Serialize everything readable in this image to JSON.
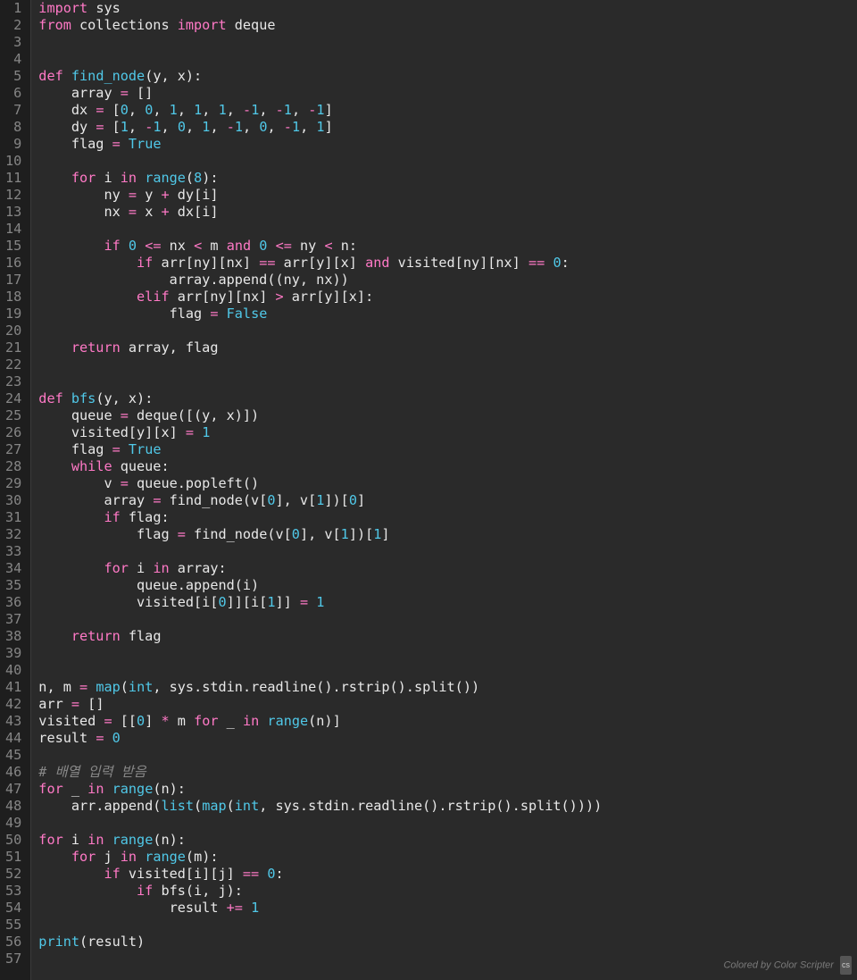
{
  "gutter": {
    "start": 1,
    "end": 57
  },
  "footer": {
    "text": "Colored by Color Scripter",
    "badge": "cs"
  },
  "code": [
    [
      {
        "c": "kw",
        "t": "import"
      },
      {
        "c": "id",
        "t": " sys"
      }
    ],
    [
      {
        "c": "kw",
        "t": "from"
      },
      {
        "c": "id",
        "t": " collections "
      },
      {
        "c": "kw",
        "t": "import"
      },
      {
        "c": "id",
        "t": " deque"
      }
    ],
    [
      {
        "c": "id",
        "t": " "
      }
    ],
    [
      {
        "c": "id",
        "t": " "
      }
    ],
    [
      {
        "c": "kw",
        "t": "def"
      },
      {
        "c": "id",
        "t": " "
      },
      {
        "c": "fn",
        "t": "find_node"
      },
      {
        "c": "id",
        "t": "(y, x):"
      }
    ],
    [
      {
        "c": "id",
        "t": "    array "
      },
      {
        "c": "op",
        "t": "="
      },
      {
        "c": "id",
        "t": " []"
      }
    ],
    [
      {
        "c": "id",
        "t": "    dx "
      },
      {
        "c": "op",
        "t": "="
      },
      {
        "c": "id",
        "t": " ["
      },
      {
        "c": "num",
        "t": "0"
      },
      {
        "c": "id",
        "t": ", "
      },
      {
        "c": "num",
        "t": "0"
      },
      {
        "c": "id",
        "t": ", "
      },
      {
        "c": "num",
        "t": "1"
      },
      {
        "c": "id",
        "t": ", "
      },
      {
        "c": "num",
        "t": "1"
      },
      {
        "c": "id",
        "t": ", "
      },
      {
        "c": "num",
        "t": "1"
      },
      {
        "c": "id",
        "t": ", "
      },
      {
        "c": "op",
        "t": "-"
      },
      {
        "c": "num",
        "t": "1"
      },
      {
        "c": "id",
        "t": ", "
      },
      {
        "c": "op",
        "t": "-"
      },
      {
        "c": "num",
        "t": "1"
      },
      {
        "c": "id",
        "t": ", "
      },
      {
        "c": "op",
        "t": "-"
      },
      {
        "c": "num",
        "t": "1"
      },
      {
        "c": "id",
        "t": "]"
      }
    ],
    [
      {
        "c": "id",
        "t": "    dy "
      },
      {
        "c": "op",
        "t": "="
      },
      {
        "c": "id",
        "t": " ["
      },
      {
        "c": "num",
        "t": "1"
      },
      {
        "c": "id",
        "t": ", "
      },
      {
        "c": "op",
        "t": "-"
      },
      {
        "c": "num",
        "t": "1"
      },
      {
        "c": "id",
        "t": ", "
      },
      {
        "c": "num",
        "t": "0"
      },
      {
        "c": "id",
        "t": ", "
      },
      {
        "c": "num",
        "t": "1"
      },
      {
        "c": "id",
        "t": ", "
      },
      {
        "c": "op",
        "t": "-"
      },
      {
        "c": "num",
        "t": "1"
      },
      {
        "c": "id",
        "t": ", "
      },
      {
        "c": "num",
        "t": "0"
      },
      {
        "c": "id",
        "t": ", "
      },
      {
        "c": "op",
        "t": "-"
      },
      {
        "c": "num",
        "t": "1"
      },
      {
        "c": "id",
        "t": ", "
      },
      {
        "c": "num",
        "t": "1"
      },
      {
        "c": "id",
        "t": "]"
      }
    ],
    [
      {
        "c": "id",
        "t": "    flag "
      },
      {
        "c": "op",
        "t": "="
      },
      {
        "c": "id",
        "t": " "
      },
      {
        "c": "fn",
        "t": "True"
      }
    ],
    [
      {
        "c": "id",
        "t": " "
      }
    ],
    [
      {
        "c": "id",
        "t": "    "
      },
      {
        "c": "kw",
        "t": "for"
      },
      {
        "c": "id",
        "t": " i "
      },
      {
        "c": "kw",
        "t": "in"
      },
      {
        "c": "id",
        "t": " "
      },
      {
        "c": "fn",
        "t": "range"
      },
      {
        "c": "id",
        "t": "("
      },
      {
        "c": "num",
        "t": "8"
      },
      {
        "c": "id",
        "t": "):"
      }
    ],
    [
      {
        "c": "id",
        "t": "        ny "
      },
      {
        "c": "op",
        "t": "="
      },
      {
        "c": "id",
        "t": " y "
      },
      {
        "c": "op",
        "t": "+"
      },
      {
        "c": "id",
        "t": " dy[i]"
      }
    ],
    [
      {
        "c": "id",
        "t": "        nx "
      },
      {
        "c": "op",
        "t": "="
      },
      {
        "c": "id",
        "t": " x "
      },
      {
        "c": "op",
        "t": "+"
      },
      {
        "c": "id",
        "t": " dx[i]"
      }
    ],
    [
      {
        "c": "id",
        "t": " "
      }
    ],
    [
      {
        "c": "id",
        "t": "        "
      },
      {
        "c": "kw",
        "t": "if"
      },
      {
        "c": "id",
        "t": " "
      },
      {
        "c": "num",
        "t": "0"
      },
      {
        "c": "id",
        "t": " "
      },
      {
        "c": "op",
        "t": "<="
      },
      {
        "c": "id",
        "t": " nx "
      },
      {
        "c": "op",
        "t": "<"
      },
      {
        "c": "id",
        "t": " m "
      },
      {
        "c": "kw",
        "t": "and"
      },
      {
        "c": "id",
        "t": " "
      },
      {
        "c": "num",
        "t": "0"
      },
      {
        "c": "id",
        "t": " "
      },
      {
        "c": "op",
        "t": "<="
      },
      {
        "c": "id",
        "t": " ny "
      },
      {
        "c": "op",
        "t": "<"
      },
      {
        "c": "id",
        "t": " n:"
      }
    ],
    [
      {
        "c": "id",
        "t": "            "
      },
      {
        "c": "kw",
        "t": "if"
      },
      {
        "c": "id",
        "t": " arr[ny][nx] "
      },
      {
        "c": "op",
        "t": "=="
      },
      {
        "c": "id",
        "t": " arr[y][x] "
      },
      {
        "c": "kw",
        "t": "and"
      },
      {
        "c": "id",
        "t": " visited[ny][nx] "
      },
      {
        "c": "op",
        "t": "=="
      },
      {
        "c": "id",
        "t": " "
      },
      {
        "c": "num",
        "t": "0"
      },
      {
        "c": "id",
        "t": ":"
      }
    ],
    [
      {
        "c": "id",
        "t": "                array.append((ny, nx))"
      }
    ],
    [
      {
        "c": "id",
        "t": "            "
      },
      {
        "c": "kw",
        "t": "elif"
      },
      {
        "c": "id",
        "t": " arr[ny][nx] "
      },
      {
        "c": "op",
        "t": ">"
      },
      {
        "c": "id",
        "t": " arr[y][x]:"
      }
    ],
    [
      {
        "c": "id",
        "t": "                flag "
      },
      {
        "c": "op",
        "t": "="
      },
      {
        "c": "id",
        "t": " "
      },
      {
        "c": "fn",
        "t": "False"
      }
    ],
    [
      {
        "c": "id",
        "t": " "
      }
    ],
    [
      {
        "c": "id",
        "t": "    "
      },
      {
        "c": "kw",
        "t": "return"
      },
      {
        "c": "id",
        "t": " array, flag"
      }
    ],
    [
      {
        "c": "id",
        "t": " "
      }
    ],
    [
      {
        "c": "id",
        "t": " "
      }
    ],
    [
      {
        "c": "kw",
        "t": "def"
      },
      {
        "c": "id",
        "t": " "
      },
      {
        "c": "fn",
        "t": "bfs"
      },
      {
        "c": "id",
        "t": "(y, x):"
      }
    ],
    [
      {
        "c": "id",
        "t": "    queue "
      },
      {
        "c": "op",
        "t": "="
      },
      {
        "c": "id",
        "t": " deque([(y, x)])"
      }
    ],
    [
      {
        "c": "id",
        "t": "    visited[y][x] "
      },
      {
        "c": "op",
        "t": "="
      },
      {
        "c": "id",
        "t": " "
      },
      {
        "c": "num",
        "t": "1"
      }
    ],
    [
      {
        "c": "id",
        "t": "    flag "
      },
      {
        "c": "op",
        "t": "="
      },
      {
        "c": "id",
        "t": " "
      },
      {
        "c": "fn",
        "t": "True"
      }
    ],
    [
      {
        "c": "id",
        "t": "    "
      },
      {
        "c": "kw",
        "t": "while"
      },
      {
        "c": "id",
        "t": " queue:"
      }
    ],
    [
      {
        "c": "id",
        "t": "        v "
      },
      {
        "c": "op",
        "t": "="
      },
      {
        "c": "id",
        "t": " queue.popleft()"
      }
    ],
    [
      {
        "c": "id",
        "t": "        array "
      },
      {
        "c": "op",
        "t": "="
      },
      {
        "c": "id",
        "t": " find_node(v["
      },
      {
        "c": "num",
        "t": "0"
      },
      {
        "c": "id",
        "t": "], v["
      },
      {
        "c": "num",
        "t": "1"
      },
      {
        "c": "id",
        "t": "])["
      },
      {
        "c": "num",
        "t": "0"
      },
      {
        "c": "id",
        "t": "]"
      }
    ],
    [
      {
        "c": "id",
        "t": "        "
      },
      {
        "c": "kw",
        "t": "if"
      },
      {
        "c": "id",
        "t": " flag:"
      }
    ],
    [
      {
        "c": "id",
        "t": "            flag "
      },
      {
        "c": "op",
        "t": "="
      },
      {
        "c": "id",
        "t": " find_node(v["
      },
      {
        "c": "num",
        "t": "0"
      },
      {
        "c": "id",
        "t": "], v["
      },
      {
        "c": "num",
        "t": "1"
      },
      {
        "c": "id",
        "t": "])["
      },
      {
        "c": "num",
        "t": "1"
      },
      {
        "c": "id",
        "t": "]"
      }
    ],
    [
      {
        "c": "id",
        "t": " "
      }
    ],
    [
      {
        "c": "id",
        "t": "        "
      },
      {
        "c": "kw",
        "t": "for"
      },
      {
        "c": "id",
        "t": " i "
      },
      {
        "c": "kw",
        "t": "in"
      },
      {
        "c": "id",
        "t": " array:"
      }
    ],
    [
      {
        "c": "id",
        "t": "            queue.append(i)"
      }
    ],
    [
      {
        "c": "id",
        "t": "            visited[i["
      },
      {
        "c": "num",
        "t": "0"
      },
      {
        "c": "id",
        "t": "]][i["
      },
      {
        "c": "num",
        "t": "1"
      },
      {
        "c": "id",
        "t": "]] "
      },
      {
        "c": "op",
        "t": "="
      },
      {
        "c": "id",
        "t": " "
      },
      {
        "c": "num",
        "t": "1"
      }
    ],
    [
      {
        "c": "id",
        "t": " "
      }
    ],
    [
      {
        "c": "id",
        "t": "    "
      },
      {
        "c": "kw",
        "t": "return"
      },
      {
        "c": "id",
        "t": " flag"
      }
    ],
    [
      {
        "c": "id",
        "t": " "
      }
    ],
    [
      {
        "c": "id",
        "t": " "
      }
    ],
    [
      {
        "c": "id",
        "t": "n, m "
      },
      {
        "c": "op",
        "t": "="
      },
      {
        "c": "id",
        "t": " "
      },
      {
        "c": "fn",
        "t": "map"
      },
      {
        "c": "id",
        "t": "("
      },
      {
        "c": "fn",
        "t": "int"
      },
      {
        "c": "id",
        "t": ", sys.stdin.readline().rstrip().split())"
      }
    ],
    [
      {
        "c": "id",
        "t": "arr "
      },
      {
        "c": "op",
        "t": "="
      },
      {
        "c": "id",
        "t": " []"
      }
    ],
    [
      {
        "c": "id",
        "t": "visited "
      },
      {
        "c": "op",
        "t": "="
      },
      {
        "c": "id",
        "t": " [["
      },
      {
        "c": "num",
        "t": "0"
      },
      {
        "c": "id",
        "t": "] "
      },
      {
        "c": "op",
        "t": "*"
      },
      {
        "c": "id",
        "t": " m "
      },
      {
        "c": "kw",
        "t": "for"
      },
      {
        "c": "id",
        "t": " _ "
      },
      {
        "c": "kw",
        "t": "in"
      },
      {
        "c": "id",
        "t": " "
      },
      {
        "c": "fn",
        "t": "range"
      },
      {
        "c": "id",
        "t": "(n)]"
      }
    ],
    [
      {
        "c": "id",
        "t": "result "
      },
      {
        "c": "op",
        "t": "="
      },
      {
        "c": "id",
        "t": " "
      },
      {
        "c": "num",
        "t": "0"
      }
    ],
    [
      {
        "c": "id",
        "t": " "
      }
    ],
    [
      {
        "c": "cm",
        "t": "# 배열 입력 받음"
      }
    ],
    [
      {
        "c": "kw",
        "t": "for"
      },
      {
        "c": "id",
        "t": " _ "
      },
      {
        "c": "kw",
        "t": "in"
      },
      {
        "c": "id",
        "t": " "
      },
      {
        "c": "fn",
        "t": "range"
      },
      {
        "c": "id",
        "t": "(n):"
      }
    ],
    [
      {
        "c": "id",
        "t": "    arr.append("
      },
      {
        "c": "fn",
        "t": "list"
      },
      {
        "c": "id",
        "t": "("
      },
      {
        "c": "fn",
        "t": "map"
      },
      {
        "c": "id",
        "t": "("
      },
      {
        "c": "fn",
        "t": "int"
      },
      {
        "c": "id",
        "t": ", sys.stdin.readline().rstrip().split())))"
      }
    ],
    [
      {
        "c": "id",
        "t": " "
      }
    ],
    [
      {
        "c": "kw",
        "t": "for"
      },
      {
        "c": "id",
        "t": " i "
      },
      {
        "c": "kw",
        "t": "in"
      },
      {
        "c": "id",
        "t": " "
      },
      {
        "c": "fn",
        "t": "range"
      },
      {
        "c": "id",
        "t": "(n):"
      }
    ],
    [
      {
        "c": "id",
        "t": "    "
      },
      {
        "c": "kw",
        "t": "for"
      },
      {
        "c": "id",
        "t": " j "
      },
      {
        "c": "kw",
        "t": "in"
      },
      {
        "c": "id",
        "t": " "
      },
      {
        "c": "fn",
        "t": "range"
      },
      {
        "c": "id",
        "t": "(m):"
      }
    ],
    [
      {
        "c": "id",
        "t": "        "
      },
      {
        "c": "kw",
        "t": "if"
      },
      {
        "c": "id",
        "t": " visited[i][j] "
      },
      {
        "c": "op",
        "t": "=="
      },
      {
        "c": "id",
        "t": " "
      },
      {
        "c": "num",
        "t": "0"
      },
      {
        "c": "id",
        "t": ":"
      }
    ],
    [
      {
        "c": "id",
        "t": "            "
      },
      {
        "c": "kw",
        "t": "if"
      },
      {
        "c": "id",
        "t": " bfs(i, j):"
      }
    ],
    [
      {
        "c": "id",
        "t": "                result "
      },
      {
        "c": "op",
        "t": "+="
      },
      {
        "c": "id",
        "t": " "
      },
      {
        "c": "num",
        "t": "1"
      }
    ],
    [
      {
        "c": "id",
        "t": " "
      }
    ],
    [
      {
        "c": "fn",
        "t": "print"
      },
      {
        "c": "id",
        "t": "(result)"
      }
    ],
    [
      {
        "c": "id",
        "t": " "
      }
    ]
  ]
}
